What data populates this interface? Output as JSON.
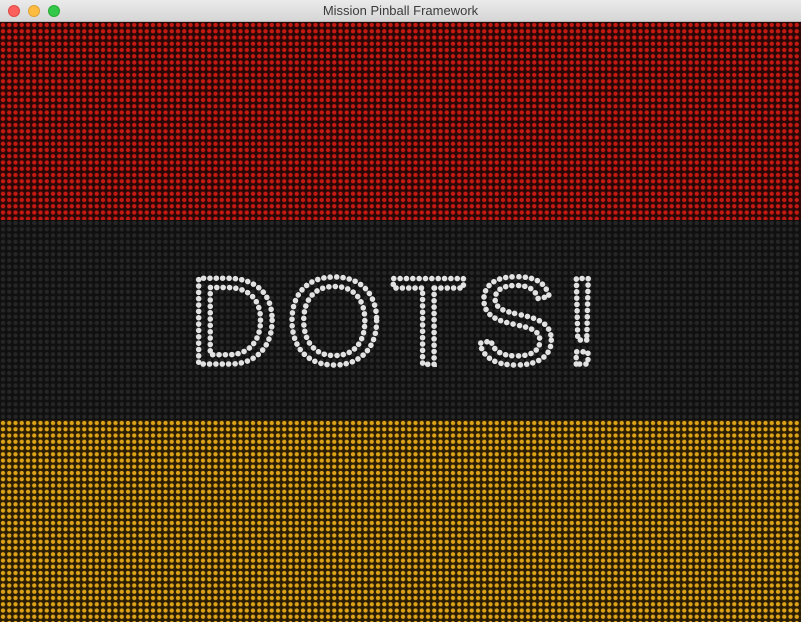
{
  "window": {
    "title": "Mission Pinball Framework"
  },
  "display": {
    "message": "DOTS!",
    "bands": [
      {
        "name": "red",
        "color": "#c41a12"
      },
      {
        "name": "dark",
        "color": "#262626"
      },
      {
        "name": "amber",
        "color": "#dba21a"
      }
    ],
    "text_color": "#e2e2e2"
  }
}
